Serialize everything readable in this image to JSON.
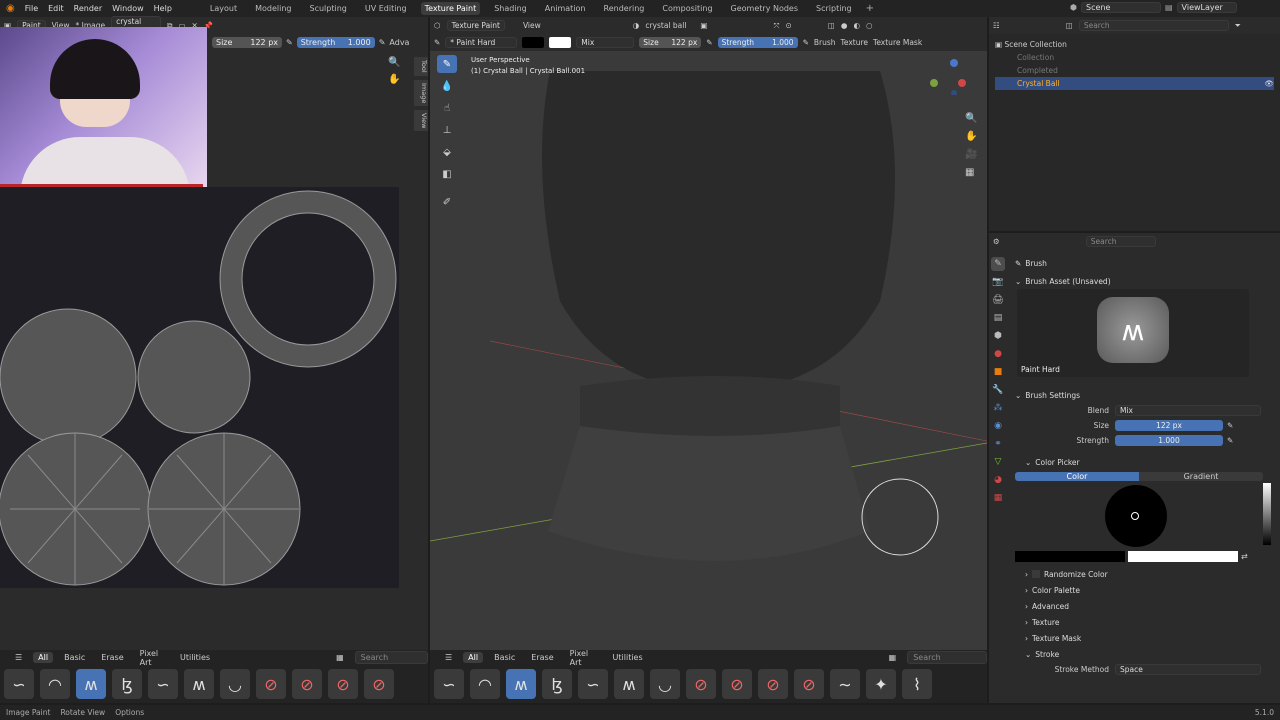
{
  "topbar": {
    "menus": [
      "File",
      "Edit",
      "Render",
      "Window",
      "Help"
    ],
    "workspaces": [
      "Layout",
      "Modeling",
      "Sculpting",
      "UV Editing",
      "Texture Paint",
      "Shading",
      "Animation",
      "Rendering",
      "Compositing",
      "Geometry Nodes",
      "Scripting"
    ],
    "active_workspace": "Texture Paint",
    "scene": "Scene",
    "view_layer": "ViewLayer"
  },
  "image_editor": {
    "mode": "Paint",
    "view_menu": "View",
    "image_menu": "* Image",
    "image_name": "crystal ball",
    "size_label": "Size",
    "size_value": "122 px",
    "strength_label": "Strength",
    "strength_value": "1.000",
    "adv_label": "Adva",
    "side_tabs": [
      "Tool",
      "Image",
      "View"
    ]
  },
  "viewport": {
    "mode": "Texture Paint",
    "view_menu": "View",
    "object_name": "crystal ball",
    "brush_name": "* Paint Hard",
    "blend": "Mix",
    "size_label": "Size",
    "size_value": "122 px",
    "strength_label": "Strength",
    "strength_value": "1.000",
    "menus": [
      "Brush",
      "Texture",
      "Texture Mask"
    ],
    "overlay_title": "User Perspective",
    "overlay_subtitle": "(1) Crystal Ball | Crystal Ball.001"
  },
  "asset_shelf_left": {
    "tabs": [
      "All",
      "Basic",
      "Erase",
      "Pixel Art",
      "Utilities"
    ],
    "active_tab": "All",
    "search_placeholder": "Search"
  },
  "asset_shelf_right": {
    "tabs": [
      "All",
      "Basic",
      "Erase",
      "Pixel Art",
      "Utilities"
    ],
    "active_tab": "All",
    "search_placeholder": "Search"
  },
  "outliner": {
    "search_placeholder": "Search",
    "root": "Scene Collection",
    "items": [
      {
        "label": "Collection",
        "dim": true
      },
      {
        "label": "Completed",
        "dim": true
      },
      {
        "label": "Crystal Ball",
        "dim": false
      }
    ]
  },
  "properties": {
    "search_placeholder": "Search",
    "context_title": "Brush",
    "brush_asset_header": "Brush Asset (Unsaved)",
    "brush_preview_name": "Paint Hard",
    "brush_settings_header": "Brush Settings",
    "blend_label": "Blend",
    "blend_value": "Mix",
    "size_label": "Size",
    "size_value": "122 px",
    "strength_label": "Strength",
    "strength_value": "1.000",
    "color_picker_header": "Color Picker",
    "color_tab": "Color",
    "gradient_tab": "Gradient",
    "randomize_color": "Randomize Color",
    "collapsed_panels": [
      "Color Palette",
      "Advanced",
      "Texture",
      "Texture Mask"
    ],
    "stroke_header": "Stroke",
    "stroke_method_label": "Stroke Method",
    "stroke_method_value": "Space"
  },
  "statusbar": {
    "items": [
      "Image Paint",
      "Rotate View",
      "Options"
    ],
    "version": "5.1.0"
  },
  "colors": {
    "accent": "#4772b3",
    "panel": "#2b2b2b",
    "background": "#1d1d1d",
    "viewport": "#3a3a3a",
    "uv_canvas": "#1e1e24"
  }
}
